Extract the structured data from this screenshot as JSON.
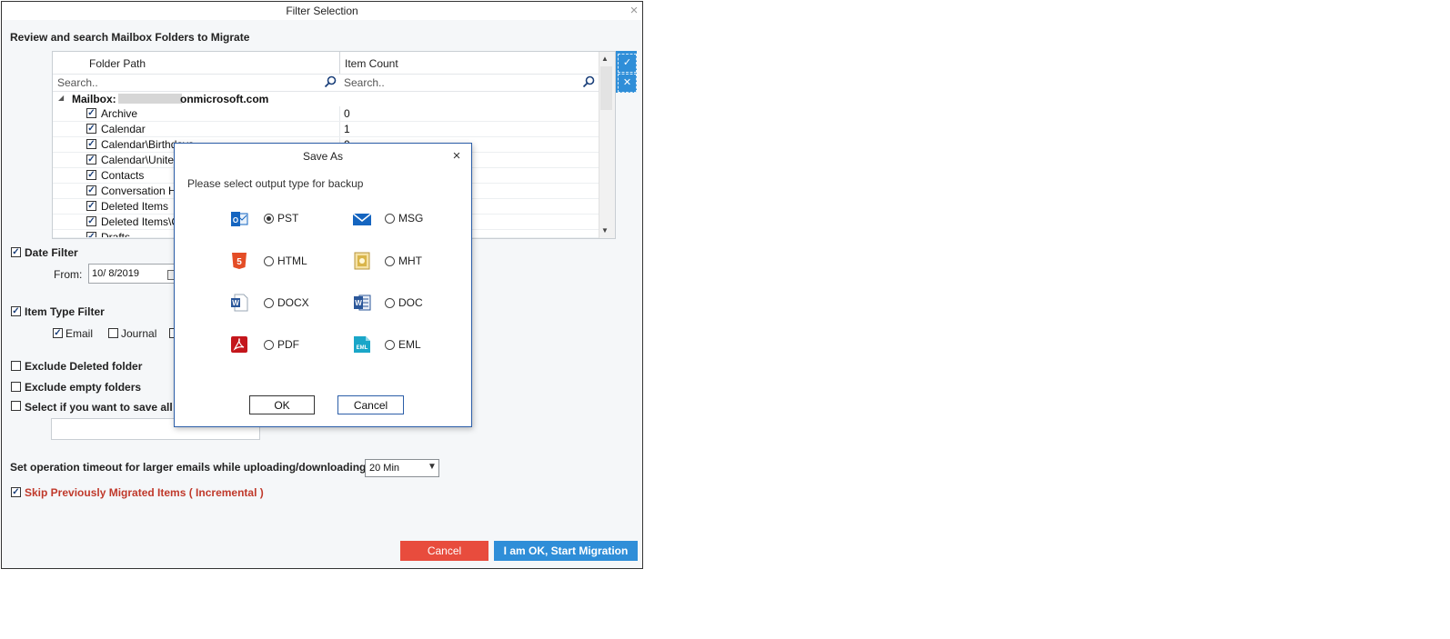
{
  "window": {
    "title": "Filter Selection",
    "close_glyph": "×"
  },
  "section_title": "Review and search Mailbox Folders to Migrate",
  "grid": {
    "columns": [
      "Folder Path",
      "Item Count"
    ],
    "search_placeholder": "Search..",
    "mailbox_label": "Mailbox:",
    "mailbox_domain": "onmicrosoft.com",
    "rows": [
      {
        "name": "Archive",
        "count": "0"
      },
      {
        "name": "Calendar",
        "count": "1"
      },
      {
        "name": "Calendar\\Birthdays",
        "count": "0"
      },
      {
        "name": "Calendar\\United S",
        "count": ""
      },
      {
        "name": "Contacts",
        "count": ""
      },
      {
        "name": "Conversation Hist",
        "count": ""
      },
      {
        "name": "Deleted Items",
        "count": ""
      },
      {
        "name": "Deleted Items\\Ca",
        "count": ""
      },
      {
        "name": "Drafts",
        "count": ""
      }
    ]
  },
  "filters": {
    "date_filter": "Date Filter",
    "from_label": "From:",
    "from_value": "10/  8/2019",
    "item_type_filter": "Item Type Filter",
    "email": "Email",
    "journal": "Journal",
    "exclude_deleted": "Exclude Deleted folder",
    "exclude_empty": "Exclude empty folders",
    "save_all": "Select if you want to save all dat",
    "timeout_label": "Set operation timeout for larger emails while uploading/downloading",
    "timeout_value": "20 Min",
    "skip_migrated": "Skip Previously Migrated Items ( Incremental )"
  },
  "footer": {
    "cancel": "Cancel",
    "start": "I am OK, Start Migration"
  },
  "dialog": {
    "title": "Save As",
    "close_glyph": "×",
    "prompt": "Please select output type for backup",
    "formats": [
      {
        "label": "PST",
        "icon": "outlook-icon",
        "selected": true
      },
      {
        "label": "MSG",
        "icon": "envelope-icon",
        "selected": false
      },
      {
        "label": "HTML",
        "icon": "html5-icon",
        "selected": false
      },
      {
        "label": "MHT",
        "icon": "mht-icon",
        "selected": false
      },
      {
        "label": "DOCX",
        "icon": "docx-icon",
        "selected": false
      },
      {
        "label": "DOC",
        "icon": "word-icon",
        "selected": false
      },
      {
        "label": "PDF",
        "icon": "pdf-icon",
        "selected": false
      },
      {
        "label": "EML",
        "icon": "eml-icon",
        "selected": false
      }
    ],
    "ok": "OK",
    "cancel": "Cancel"
  },
  "colors": {
    "accent_blue": "#2f8ed8",
    "cancel_red": "#e84c3d",
    "incremental_red": "#c0392b"
  }
}
